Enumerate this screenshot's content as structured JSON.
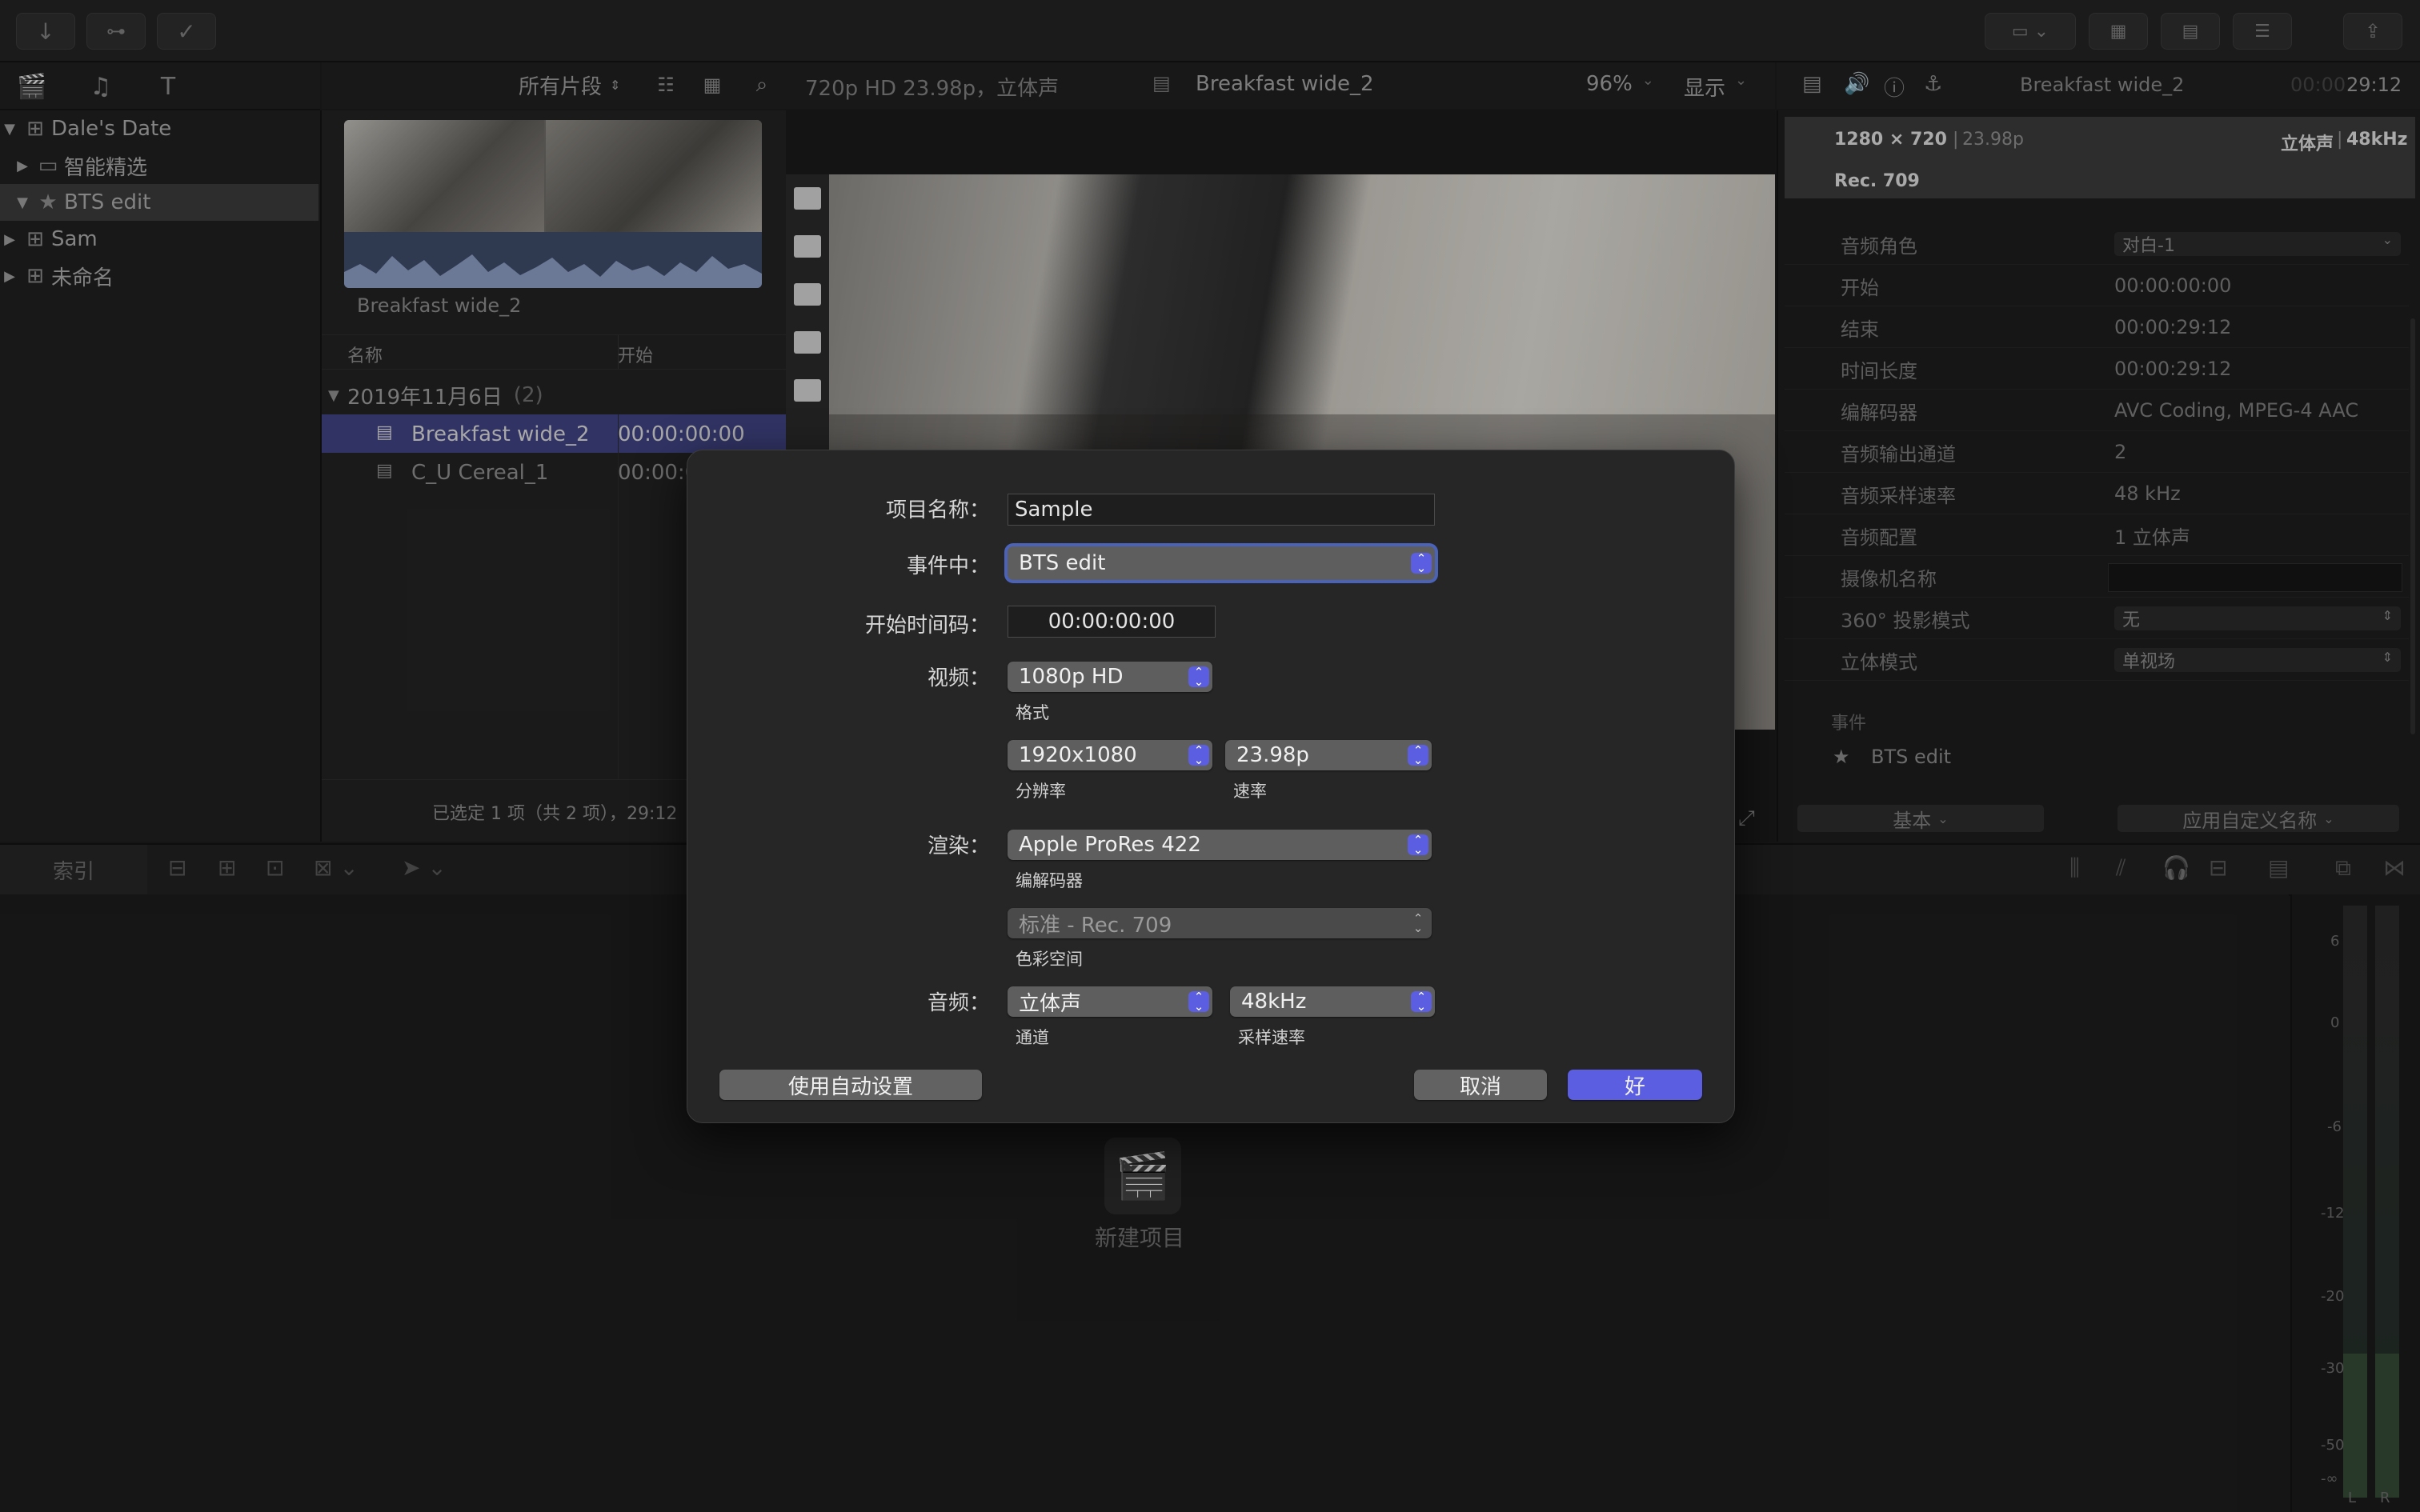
{
  "toolbar": {
    "import_icon": "download-icon",
    "keyword_icon": "key-icon",
    "check_icon": "checkmark-icon"
  },
  "library": {
    "filter_label": "所有片段",
    "items": [
      {
        "label": "Dale's Date",
        "level": 0,
        "expanded": true
      },
      {
        "label": "智能精选",
        "level": 1,
        "expanded": false
      },
      {
        "label": "BTS edit",
        "level": 1,
        "expanded": true,
        "selected": true
      },
      {
        "label": "Sam",
        "level": 0,
        "expanded": false
      },
      {
        "label": "未命名",
        "level": 0,
        "expanded": false
      }
    ]
  },
  "browser": {
    "thumb_title": "Breakfast wide_2",
    "col_name": "名称",
    "col_start": "开始",
    "group_label": "2019年11月6日",
    "group_count": "(2)",
    "rows": [
      {
        "name": "Breakfast wide_2",
        "start": "00:00:00:00",
        "selected": true
      },
      {
        "name": "C_U Cereal_1",
        "start": "00:00:0"
      }
    ],
    "status": "已选定 1 项（共 2 项），29:12"
  },
  "viewer": {
    "format": "720p HD 23.98p，立体声",
    "clip_name": "Breakfast wide_2",
    "zoom": "96%",
    "display_label": "显示"
  },
  "inspector": {
    "clip_name": "Breakfast wide_2",
    "timecode_dim": "00:00",
    "timecode": "29:12",
    "resolution": "1280 × 720",
    "framerate": "23.98p",
    "audio_summary": "立体声",
    "audio_rate": "48kHz",
    "color_space": "Rec. 709",
    "rows": [
      {
        "key": "音频角色",
        "value": "对白-1",
        "type": "select"
      },
      {
        "key": "开始",
        "value": "00:00:00:00"
      },
      {
        "key": "结束",
        "value": "00:00:29:12"
      },
      {
        "key": "时间长度",
        "value": "00:00:29:12"
      },
      {
        "key": "编解码器",
        "value": "AVC Coding, MPEG-4 AAC"
      },
      {
        "key": "音频输出通道",
        "value": "2"
      },
      {
        "key": "音频采样速率",
        "value": "48 kHz"
      },
      {
        "key": "音频配置",
        "value": "1 立体声"
      },
      {
        "key": "摄像机名称",
        "value": "",
        "type": "field"
      },
      {
        "key": "360° 投影模式",
        "value": "无",
        "type": "select"
      },
      {
        "key": "立体模式",
        "value": "单视场",
        "type": "select"
      }
    ],
    "event_heading": "事件",
    "event_name": "BTS edit",
    "basic_button": "基本",
    "custom_name_button": "应用自定义名称"
  },
  "timeline": {
    "index_tab": "索引",
    "new_project_label": "新建项目",
    "meter_labels": [
      "6",
      "0",
      "-6",
      "-12",
      "-20",
      "-30",
      "-50",
      "-∞"
    ],
    "meter_channels": [
      "L",
      "R"
    ]
  },
  "dialog": {
    "project_name_label": "项目名称：",
    "project_name_value": "Sample",
    "event_label": "事件中：",
    "event_value": "BTS edit",
    "start_tc_label": "开始时间码：",
    "start_tc_value": "00:00:00:00",
    "video_label": "视频：",
    "video_format": "1080p HD",
    "format_caption": "格式",
    "resolution_value": "1920x1080",
    "resolution_caption": "分辨率",
    "rate_value": "23.98p",
    "rate_caption": "速率",
    "render_label": "渲染：",
    "codec_value": "Apple ProRes 422",
    "codec_caption": "编解码器",
    "colorspace_value": "标准 - Rec. 709",
    "colorspace_caption": "色彩空间",
    "audio_label": "音频：",
    "channels_value": "立体声",
    "channels_caption": "通道",
    "samplerate_value": "48kHz",
    "samplerate_caption": "采样速率",
    "auto_settings_button": "使用自动设置",
    "cancel_button": "取消",
    "ok_button": "好"
  },
  "colors": {
    "accent": "#5b5ee0",
    "dialog_bg": "#262626",
    "selection": "#3f4280"
  }
}
